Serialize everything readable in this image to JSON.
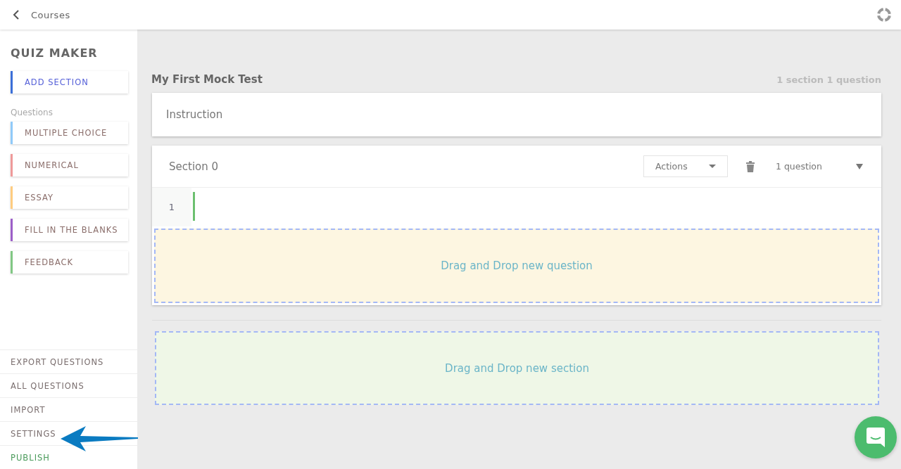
{
  "topbar": {
    "back_label": "Courses"
  },
  "sidebar": {
    "title": "QUIZ MAKER",
    "add_section": {
      "label": "ADD SECTION",
      "color": "#3b6fd8"
    },
    "questions_label": "Questions",
    "question_types": [
      {
        "label": "MULTIPLE CHOICE",
        "color": "#90caf9"
      },
      {
        "label": "NUMERICAL",
        "color": "#ef9a9a"
      },
      {
        "label": "ESSAY",
        "color": "#ffcc80"
      },
      {
        "label": "FILL IN THE BLANKS",
        "color": "#9c5fc8"
      },
      {
        "label": "FEEDBACK",
        "color": "#81c784"
      }
    ],
    "bottom_links": [
      {
        "label": "EXPORT QUESTIONS",
        "kind": "plain"
      },
      {
        "label": "ALL QUESTIONS",
        "kind": "plain"
      },
      {
        "label": "IMPORT",
        "kind": "plain"
      },
      {
        "label": "SETTINGS",
        "kind": "plain"
      },
      {
        "label": "PUBLISH",
        "kind": "publish"
      }
    ]
  },
  "test": {
    "title": "My First Mock Test",
    "summary": "1 section 1 question"
  },
  "instruction": {
    "label": "Instruction"
  },
  "section": {
    "title": "Section 0",
    "actions_label": "Actions",
    "question_count": "1 question",
    "question_numbers": [
      "1"
    ],
    "drop_question": "Drag and Drop new question"
  },
  "drop_section": "Drag and Drop new section"
}
